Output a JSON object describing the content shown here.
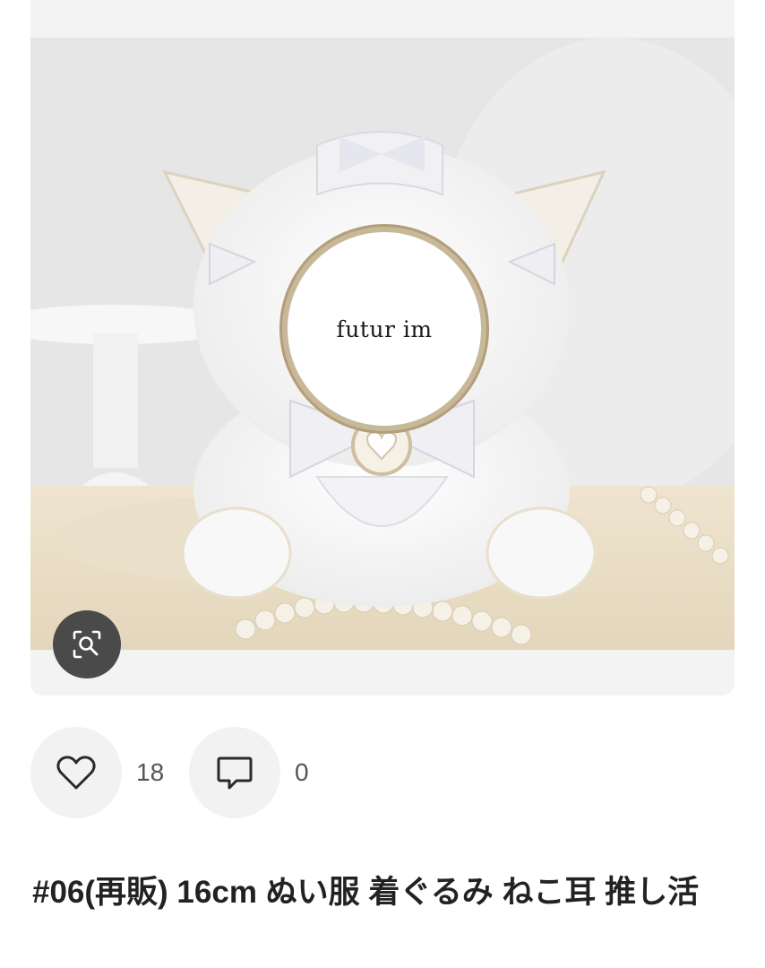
{
  "product": {
    "image_logo_text": "futur im",
    "title": "#06(再販) 16cm ぬい服 着ぐるみ ねこ耳 推し活"
  },
  "actions": {
    "likes_count": "18",
    "comments_count": "0"
  },
  "icons": {
    "visual_search": "zoom-scan-icon",
    "like": "heart-outline-icon",
    "comment": "speech-bubble-icon"
  }
}
